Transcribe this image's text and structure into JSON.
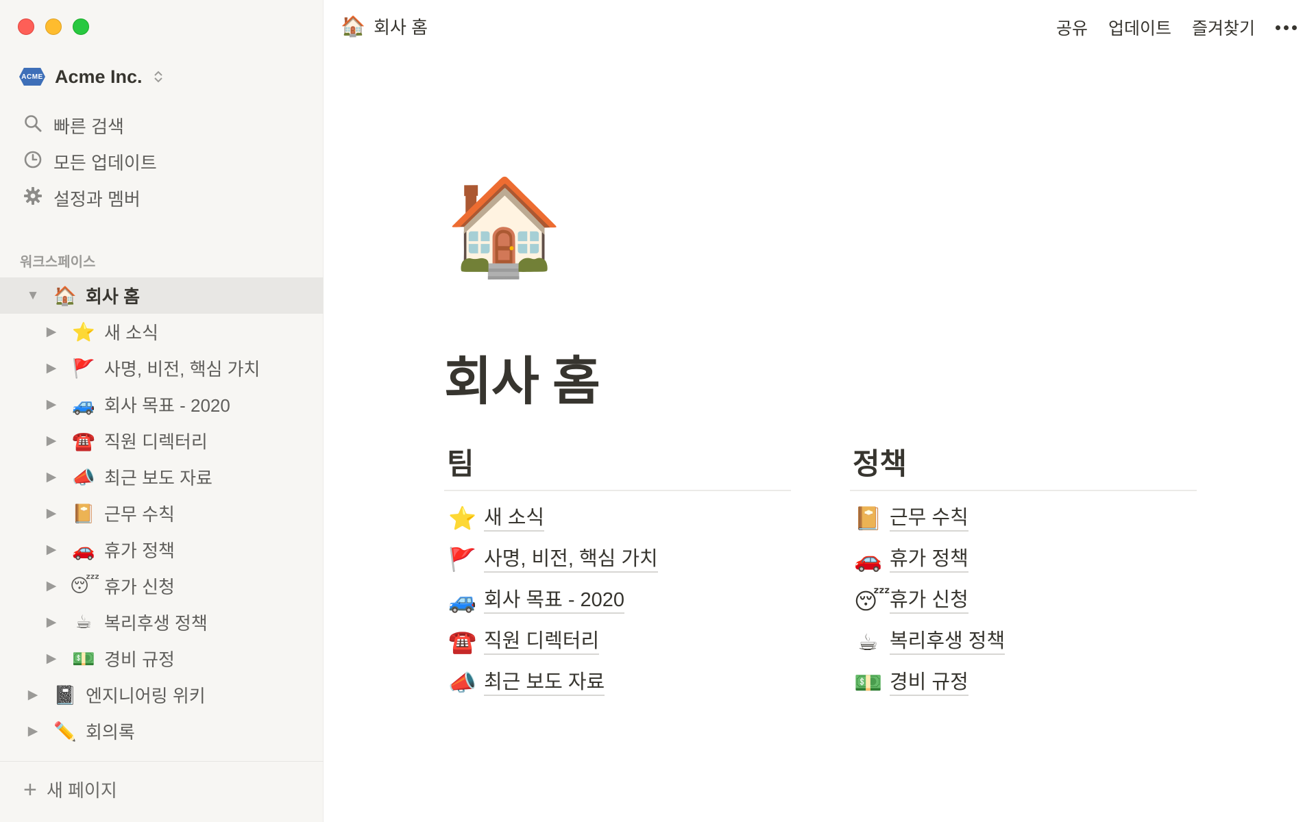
{
  "window": {
    "traffic_lights": [
      "close",
      "minimize",
      "maximize"
    ]
  },
  "workspace": {
    "logo_text": "ACME",
    "name": "Acme Inc.",
    "chevron_icon": "up-down-chevron-icon"
  },
  "nav": {
    "search": {
      "label": "빠른 검색",
      "icon": "search-icon"
    },
    "updates": {
      "label": "모든 업데이트",
      "icon": "clock-icon"
    },
    "settings": {
      "label": "설정과 멤버",
      "icon": "gear-icon"
    }
  },
  "sidebar": {
    "section_label": "워크스페이스",
    "tree": [
      {
        "emoji": "🏠",
        "label": "회사 홈",
        "expanded": true,
        "active": true
      },
      {
        "emoji": "⭐",
        "label": "새 소식"
      },
      {
        "emoji": "🚩",
        "label": "사명, 비전, 핵심 가치"
      },
      {
        "emoji": "🚙",
        "label": "회사 목표 - 2020"
      },
      {
        "emoji": "☎️",
        "label": "직원 디렉터리"
      },
      {
        "emoji": "📣",
        "label": "최근 보도 자료"
      },
      {
        "emoji": "📔",
        "label": "근무 수칙"
      },
      {
        "emoji": "🚗",
        "label": "휴가 정책"
      },
      {
        "emoji": "😴",
        "label": "휴가 신청"
      },
      {
        "emoji": "☕",
        "label": "복리후생 정책"
      },
      {
        "emoji": "💵",
        "label": "경비 규정"
      },
      {
        "emoji": "📓",
        "label": "엔지니어링 위키"
      },
      {
        "emoji": "✏️",
        "label": "회의록"
      }
    ],
    "new_page": "새 페이지"
  },
  "topbar": {
    "breadcrumb_emoji": "🏠",
    "breadcrumb_title": "회사 홈",
    "share": "공유",
    "updates": "업데이트",
    "favorites": "즐겨찾기",
    "more_icon": "more-horizontal-icon"
  },
  "page": {
    "icon": "🏠",
    "title": "회사 홈",
    "team": {
      "heading": "팀",
      "links": [
        {
          "emoji": "⭐",
          "label": "새 소식"
        },
        {
          "emoji": "🚩",
          "label": "사명, 비전, 핵심 가치"
        },
        {
          "emoji": "🚙",
          "label": "회사 목표 - 2020"
        },
        {
          "emoji": "☎️",
          "label": "직원 디렉터리"
        },
        {
          "emoji": "📣",
          "label": "최근 보도 자료"
        }
      ]
    },
    "policy": {
      "heading": "정책",
      "links": [
        {
          "emoji": "📔",
          "label": "근무 수칙"
        },
        {
          "emoji": "🚗",
          "label": "휴가 정책"
        },
        {
          "emoji": "😴",
          "label": "휴가 신청"
        },
        {
          "emoji": "☕",
          "label": "복리후생 정책"
        },
        {
          "emoji": "💵",
          "label": "경비 규정"
        }
      ]
    }
  }
}
